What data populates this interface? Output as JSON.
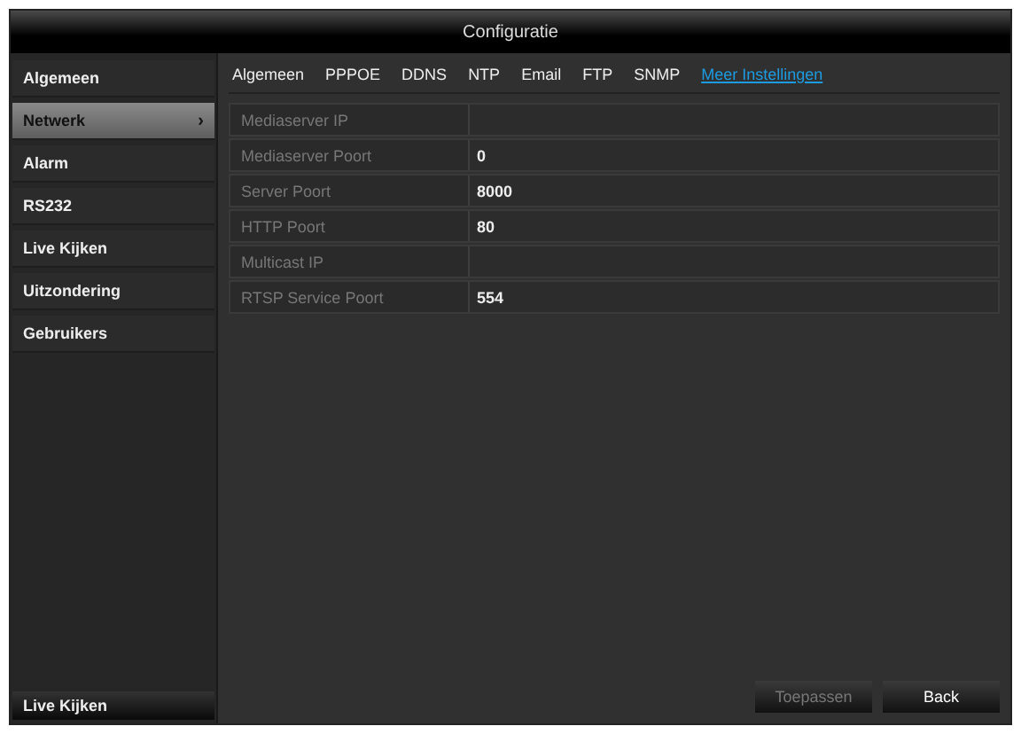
{
  "window": {
    "title": "Configuratie"
  },
  "sidebar": {
    "items": [
      {
        "label": "Algemeen",
        "selected": false
      },
      {
        "label": "Netwerk",
        "selected": true
      },
      {
        "label": "Alarm",
        "selected": false
      },
      {
        "label": "RS232",
        "selected": false
      },
      {
        "label": "Live Kijken",
        "selected": false
      },
      {
        "label": "Uitzondering",
        "selected": false
      },
      {
        "label": "Gebruikers",
        "selected": false
      }
    ],
    "arrow": "›",
    "footer": "Live Kijken"
  },
  "tabs": [
    {
      "label": "Algemeen",
      "selected": false
    },
    {
      "label": "PPPOE",
      "selected": false
    },
    {
      "label": "DDNS",
      "selected": false
    },
    {
      "label": "NTP",
      "selected": false
    },
    {
      "label": "Email",
      "selected": false
    },
    {
      "label": "FTP",
      "selected": false
    },
    {
      "label": "SNMP",
      "selected": false
    },
    {
      "label": "Meer Instellingen",
      "selected": true
    }
  ],
  "fields": [
    {
      "label": "Mediaserver IP"
    },
    {
      "label": "Mediaserver Poort",
      "value": "0"
    },
    {
      "label": "Server Poort",
      "value": "8000"
    },
    {
      "label": "HTTP Poort",
      "value": "80"
    },
    {
      "label": "Multicast IP"
    },
    {
      "label": "RTSP Service Poort",
      "value": "554"
    }
  ],
  "buttons": [
    {
      "label": "Toepassen",
      "disabled": true
    },
    {
      "label": "Back",
      "disabled": false
    }
  ]
}
